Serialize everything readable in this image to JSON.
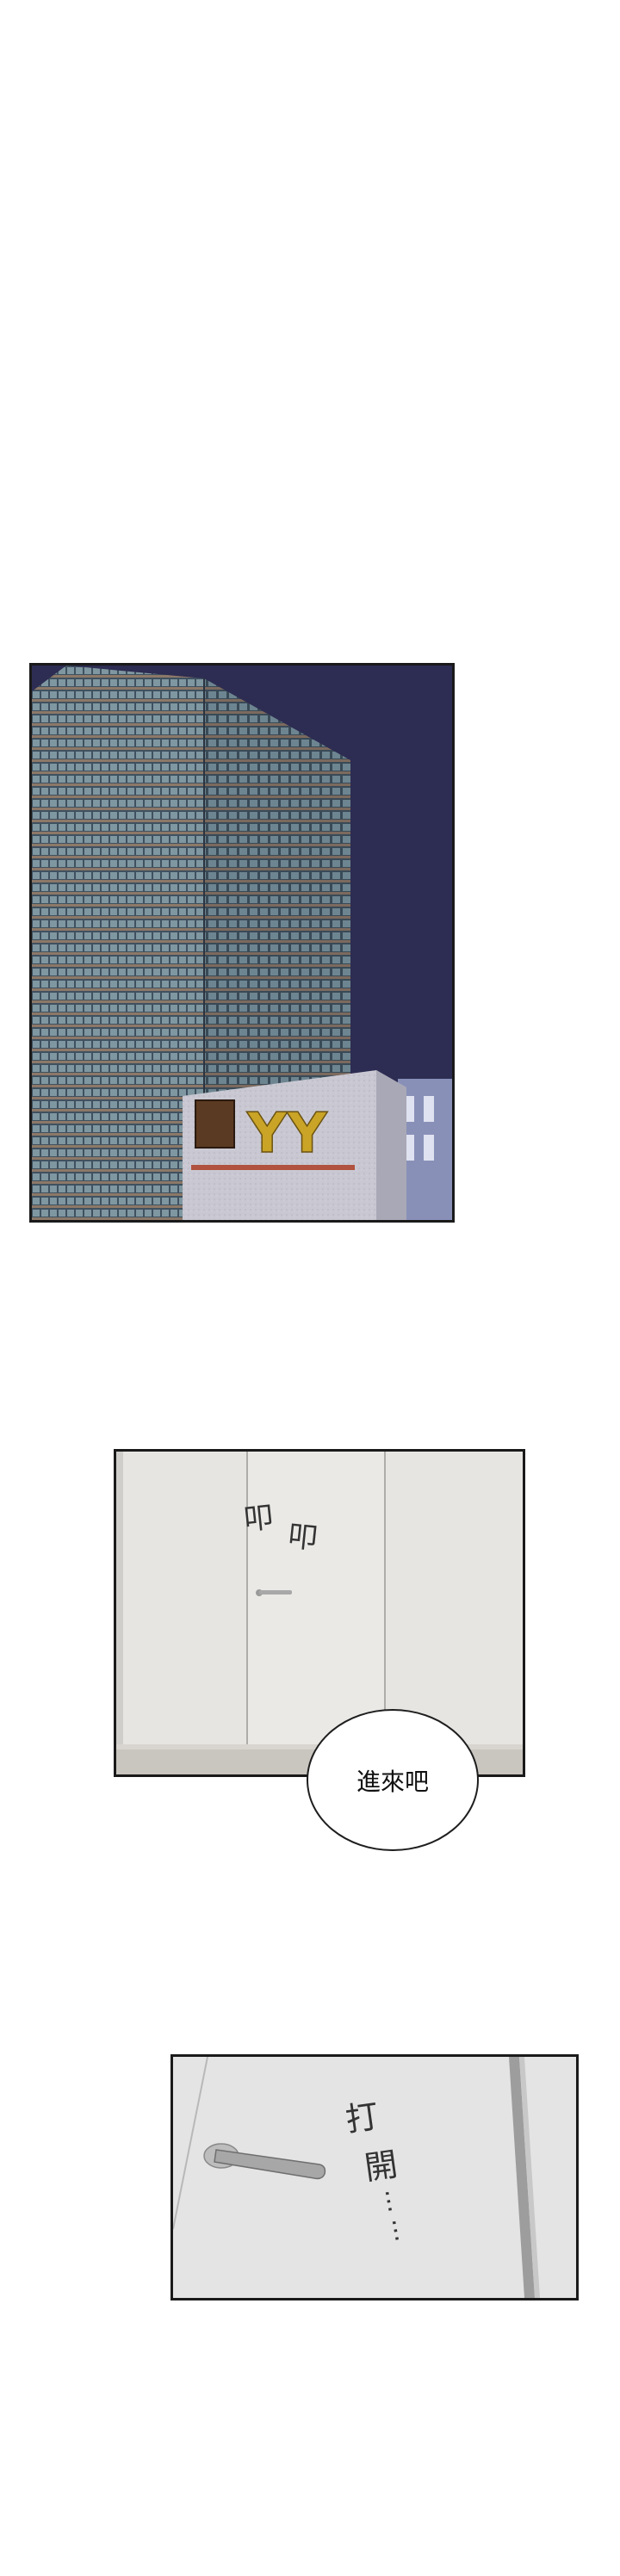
{
  "panels": [
    {
      "name": "building-panel",
      "sign_text": "YY"
    },
    {
      "name": "door-panel",
      "sfx": [
        "叩",
        "叩"
      ],
      "dialogue": "進來吧"
    },
    {
      "name": "handle-panel",
      "sfx_chars": [
        "打",
        "開",
        "…",
        "…"
      ]
    }
  ],
  "colors": {
    "night_sky": "#2d2c52",
    "building": "#4a5a66",
    "sign_wall": "#c9c8d2",
    "sign_letters": "#c9a426",
    "sign_plaque": "#5a3a22",
    "door_wall": "#e6e5e2",
    "border": "#1a1a1a"
  }
}
